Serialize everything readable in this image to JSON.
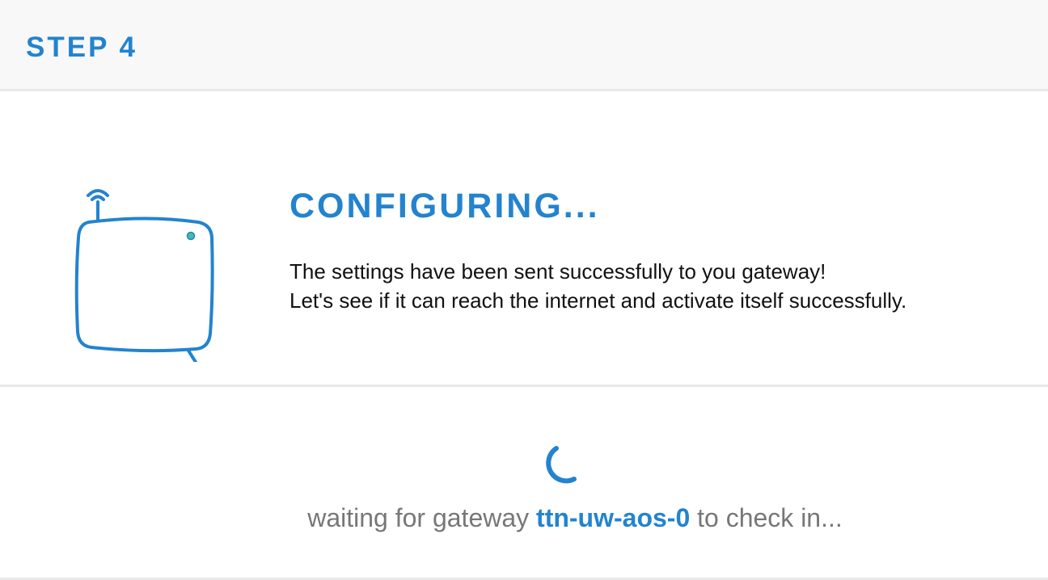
{
  "header": {
    "step_label": "STEP 4"
  },
  "configuring": {
    "title": "CONFIGURING...",
    "message_line_1": "The settings have been sent successfully to you gateway!",
    "message_line_2": "Let's see if it can reach the internet and activate itself successfully."
  },
  "waiting": {
    "prefix": "waiting for gateway ",
    "gateway_id": "ttn-uw-aos-0",
    "suffix": " to check in..."
  },
  "icons": {
    "gateway": "gateway-device-icon",
    "spinner": "loading-spinner-icon"
  },
  "colors": {
    "accent": "#2383cf",
    "status_led": "#3fbf9f",
    "muted_text": "#777777",
    "header_background": "#f8f8f8",
    "divider": "#e8e8e8"
  }
}
